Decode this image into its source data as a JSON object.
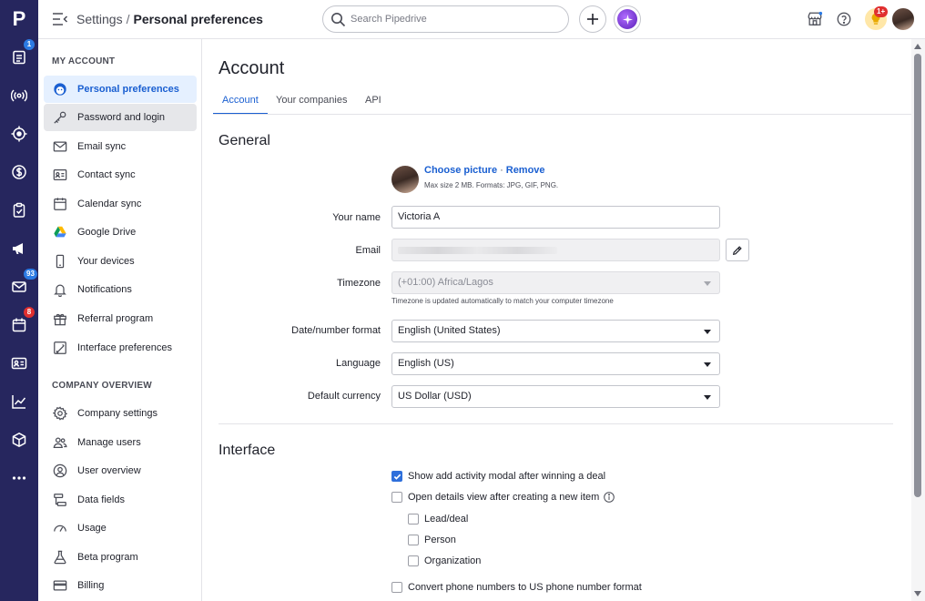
{
  "app": {
    "logo_letter": "P",
    "rail_badges": {
      "deals": "1",
      "mail": "93",
      "calendar": "8"
    }
  },
  "header": {
    "breadcrumb_parent": "Settings",
    "breadcrumb_separator": "/",
    "breadcrumb_current": "Personal preferences",
    "search_placeholder": "Search Pipedrive",
    "tips_badge": "1+"
  },
  "sidebar": {
    "my_account_title": "MY ACCOUNT",
    "my_account_items": [
      {
        "label": "Personal preferences",
        "icon": "smiley-icon",
        "state": "active"
      },
      {
        "label": "Password and login",
        "icon": "key-icon",
        "state": "hover"
      },
      {
        "label": "Email sync",
        "icon": "envelope-icon"
      },
      {
        "label": "Contact sync",
        "icon": "contact-card-icon"
      },
      {
        "label": "Calendar sync",
        "icon": "calendar-icon"
      },
      {
        "label": "Google Drive",
        "icon": "google-drive-icon"
      },
      {
        "label": "Your devices",
        "icon": "mobile-device-icon"
      },
      {
        "label": "Notifications",
        "icon": "bell-icon"
      },
      {
        "label": "Referral program",
        "icon": "gift-icon"
      },
      {
        "label": "Interface preferences",
        "icon": "interface-icon"
      }
    ],
    "company_title": "COMPANY OVERVIEW",
    "company_items": [
      {
        "label": "Company settings",
        "icon": "gear-icon"
      },
      {
        "label": "Manage users",
        "icon": "users-icon"
      },
      {
        "label": "User overview",
        "icon": "user-circle-icon"
      },
      {
        "label": "Data fields",
        "icon": "data-fields-icon"
      },
      {
        "label": "Usage",
        "icon": "gauge-icon"
      },
      {
        "label": "Beta program",
        "icon": "flask-icon"
      },
      {
        "label": "Billing",
        "icon": "credit-card-icon"
      }
    ]
  },
  "main": {
    "title": "Account",
    "tabs": [
      {
        "label": "Account",
        "active": true
      },
      {
        "label": "Your companies",
        "active": false
      },
      {
        "label": "API",
        "active": false
      }
    ],
    "general_heading": "General",
    "picture": {
      "choose_label": "Choose picture",
      "separator": "·",
      "remove_label": "Remove",
      "hint": "Max size 2 MB. Formats: JPG, GIF, PNG."
    },
    "fields": {
      "name_label": "Your name",
      "name_value": "Victoria A",
      "email_label": "Email",
      "timezone_label": "Timezone",
      "timezone_value": "(+01:00) Africa/Lagos",
      "timezone_hint": "Timezone is updated automatically to match your computer timezone",
      "date_format_label": "Date/number format",
      "date_format_value": "English (United States)",
      "language_label": "Language",
      "language_value": "English (US)",
      "currency_label": "Default currency",
      "currency_value": "US Dollar (USD)"
    },
    "interface_heading": "Interface",
    "checkboxes": [
      {
        "label": "Show add activity modal after winning a deal",
        "checked": true
      },
      {
        "label": "Open details view after creating a new item",
        "checked": false
      },
      {
        "label": "Lead/deal",
        "checked": false
      },
      {
        "label": "Person",
        "checked": false
      },
      {
        "label": "Organization",
        "checked": false
      },
      {
        "label": "Convert phone numbers to US phone number format",
        "checked": false
      }
    ]
  },
  "colors": {
    "rail_bg": "#26265e",
    "accent": "#1a5fd1",
    "checkbox_checked": "#2e6fdb",
    "badge_blue": "#2b7ae4",
    "badge_red": "#e02f2f"
  }
}
